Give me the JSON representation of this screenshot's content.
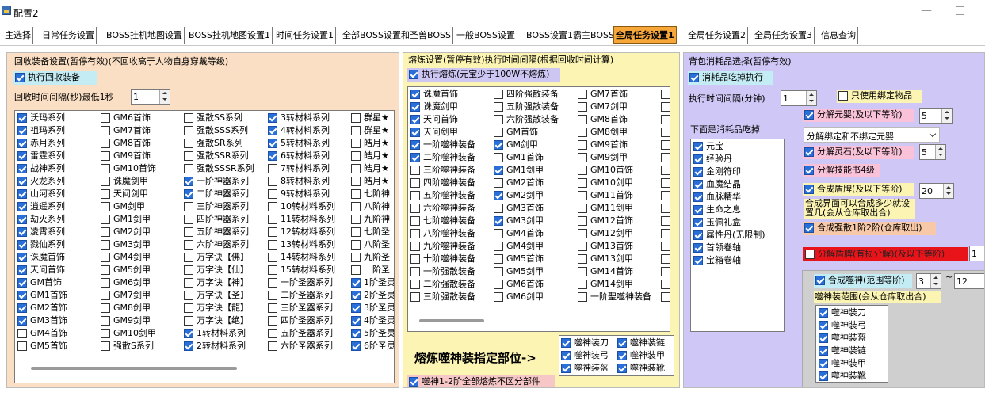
{
  "window": {
    "title": "配置2",
    "minimize": "—"
  },
  "tabs": [
    "主选择",
    "日常任务设置",
    "BOSS挂机地图设置",
    "BOSS挂机地图设置1",
    "时间任务设置1",
    "全部BOSS设置和圣兽BOSS",
    "一般BOSS设置",
    "BOSS设置1霸主BOSS",
    "全局任务设置1",
    "全局任务设置2",
    "全局任务设置3",
    "信息查询"
  ],
  "active_tab": "全局任务设置1",
  "colors": {
    "left_panel": "#fbdfc4",
    "mid_panel": "#fbf4b3",
    "right_panel": "#cfc8f6",
    "active_tab": "#f7a63a",
    "checkbox": "#2a6fd8"
  },
  "recycle": {
    "group_label": "回收装备设置(暂停有效)(不回收高于人物自身穿戴等级)",
    "exec_label": "执行回收装备",
    "interval_label": "回收时间间隔(秒)最低1秒",
    "interval_value": "1",
    "columns": [
      [
        {
          "t": "沃玛系列",
          "c": true
        },
        {
          "t": "祖玛系列",
          "c": true
        },
        {
          "t": "赤月系列",
          "c": true
        },
        {
          "t": "雷霆系列",
          "c": true
        },
        {
          "t": "战神系列",
          "c": true
        },
        {
          "t": "火龙系列",
          "c": true
        },
        {
          "t": "山河系列",
          "c": true
        },
        {
          "t": "逍遥系列",
          "c": true
        },
        {
          "t": "劫灭系列",
          "c": true
        },
        {
          "t": "凌霄系列",
          "c": true
        },
        {
          "t": "戮仙系列",
          "c": true
        },
        {
          "t": "诛魔首饰",
          "c": true
        },
        {
          "t": "天问首饰",
          "c": true
        },
        {
          "t": "GM首饰",
          "c": true
        },
        {
          "t": "GM1首饰",
          "c": true
        },
        {
          "t": "GM2首饰",
          "c": true
        },
        {
          "t": "GM3首饰",
          "c": true
        },
        {
          "t": "GM4首饰",
          "c": false
        },
        {
          "t": "GM5首饰",
          "c": false
        }
      ],
      [
        {
          "t": "GM6首饰",
          "c": false
        },
        {
          "t": "GM7首饰",
          "c": false
        },
        {
          "t": "GM8首饰",
          "c": false
        },
        {
          "t": "GM9首饰",
          "c": false
        },
        {
          "t": "GM10首饰",
          "c": false
        },
        {
          "t": "诛魔剑甲",
          "c": false
        },
        {
          "t": "天问剑甲",
          "c": false
        },
        {
          "t": "GM剑甲",
          "c": false
        },
        {
          "t": "GM1剑甲",
          "c": false
        },
        {
          "t": "GM2剑甲",
          "c": false
        },
        {
          "t": "GM3剑甲",
          "c": false
        },
        {
          "t": "GM4剑甲",
          "c": false
        },
        {
          "t": "GM5剑甲",
          "c": false
        },
        {
          "t": "GM6剑甲",
          "c": false
        },
        {
          "t": "GM7剑甲",
          "c": false
        },
        {
          "t": "GM8剑甲",
          "c": false
        },
        {
          "t": "GM9剑甲",
          "c": false
        },
        {
          "t": "GM10剑甲",
          "c": false
        },
        {
          "t": "强散S系列",
          "c": false
        }
      ],
      [
        {
          "t": "强散SS系列",
          "c": false
        },
        {
          "t": "强散SSS系列",
          "c": false
        },
        {
          "t": "强散SR系列",
          "c": false
        },
        {
          "t": "强散SSR系列",
          "c": false
        },
        {
          "t": "强散SSSR系列",
          "c": false
        },
        {
          "t": "一阶神器系列",
          "c": true
        },
        {
          "t": "二阶神器系列",
          "c": true
        },
        {
          "t": "三阶神器系列",
          "c": false
        },
        {
          "t": "四阶神器系列",
          "c": false
        },
        {
          "t": "五阶神器系列",
          "c": false
        },
        {
          "t": "六阶神器系列",
          "c": false
        },
        {
          "t": "万字诀【佛】",
          "c": false
        },
        {
          "t": "万字诀【仙】",
          "c": false
        },
        {
          "t": "万字诀【神】",
          "c": false
        },
        {
          "t": "万字诀【圣】",
          "c": false
        },
        {
          "t": "万字诀【龍】",
          "c": false
        },
        {
          "t": "万字诀【绝】",
          "c": false
        },
        {
          "t": "1转材料系列",
          "c": true
        },
        {
          "t": "2转材料系列",
          "c": true
        }
      ],
      [
        {
          "t": "3转材料系列",
          "c": true
        },
        {
          "t": "4转材料系列",
          "c": true
        },
        {
          "t": "5转材料系列",
          "c": true
        },
        {
          "t": "6转材料系列",
          "c": true
        },
        {
          "t": "7转材料系列",
          "c": false
        },
        {
          "t": "8转材料系列",
          "c": false
        },
        {
          "t": "9转材料系列",
          "c": false
        },
        {
          "t": "10转材料系列",
          "c": false
        },
        {
          "t": "11转材料系列",
          "c": false
        },
        {
          "t": "12转材料系列",
          "c": false
        },
        {
          "t": "13转材料系列",
          "c": false
        },
        {
          "t": "14转材料系列",
          "c": false
        },
        {
          "t": "15转材料系列",
          "c": false
        },
        {
          "t": "一阶圣器系列",
          "c": false
        },
        {
          "t": "二阶圣器系列",
          "c": false
        },
        {
          "t": "三阶圣器系列",
          "c": false
        },
        {
          "t": "四阶圣器系列",
          "c": false
        },
        {
          "t": "五阶圣器系列",
          "c": false
        },
        {
          "t": "六阶圣器系列",
          "c": false
        }
      ],
      [
        {
          "t": "群星★",
          "c": false
        },
        {
          "t": "群星★",
          "c": false
        },
        {
          "t": "皓月★",
          "c": false
        },
        {
          "t": "皓月★",
          "c": false
        },
        {
          "t": "皓月★",
          "c": false
        },
        {
          "t": "皓月★",
          "c": false
        },
        {
          "t": "七阶神",
          "c": false
        },
        {
          "t": "八阶神",
          "c": false
        },
        {
          "t": "九阶神",
          "c": false
        },
        {
          "t": "七阶圣",
          "c": false
        },
        {
          "t": "八阶圣",
          "c": false
        },
        {
          "t": "九阶圣",
          "c": false
        },
        {
          "t": "十阶圣",
          "c": false
        },
        {
          "t": "1阶圣灵",
          "c": true
        },
        {
          "t": "2阶圣灵",
          "c": true
        },
        {
          "t": "3阶圣灵",
          "c": true
        },
        {
          "t": "4阶圣灵",
          "c": true
        },
        {
          "t": "5阶圣灵",
          "c": true
        },
        {
          "t": "6阶圣灵",
          "c": true
        }
      ]
    ]
  },
  "smelt": {
    "group_label": "熔炼设置(暂停有效)执行时间间隔(根据回收时间计算)",
    "exec_label": "执行熔炼(元宝少于100W不熔炼)",
    "columns": [
      [
        {
          "t": "诛魔首饰",
          "c": true
        },
        {
          "t": "诛魔剑甲",
          "c": true
        },
        {
          "t": "天问首饰",
          "c": true
        },
        {
          "t": "天问剑甲",
          "c": true
        },
        {
          "t": "一阶噬神装备",
          "c": true
        },
        {
          "t": "二阶噬神装备",
          "c": true
        },
        {
          "t": "三阶噬神装备",
          "c": false
        },
        {
          "t": "四阶噬神装备",
          "c": false
        },
        {
          "t": "五阶噬神装备",
          "c": false
        },
        {
          "t": "六阶噬神装备",
          "c": false
        },
        {
          "t": "七阶噬神装备",
          "c": false
        },
        {
          "t": "八阶噬神装备",
          "c": false
        },
        {
          "t": "九阶噬神装备",
          "c": false
        },
        {
          "t": "十阶噬神装备",
          "c": false
        },
        {
          "t": "一阶强散装备",
          "c": false
        },
        {
          "t": "二阶强散装备",
          "c": false
        },
        {
          "t": "三阶强散装备",
          "c": false
        }
      ],
      [
        {
          "t": "四阶强散装备",
          "c": false
        },
        {
          "t": "五阶强散装备",
          "c": false
        },
        {
          "t": "六阶强散装备",
          "c": false
        },
        {
          "t": "GM首饰",
          "c": false
        },
        {
          "t": "GM剑甲",
          "c": true
        },
        {
          "t": "GM1首饰",
          "c": false
        },
        {
          "t": "GM1剑甲",
          "c": true
        },
        {
          "t": "GM2首饰",
          "c": false
        },
        {
          "t": "GM2剑甲",
          "c": true
        },
        {
          "t": "GM3首饰",
          "c": false
        },
        {
          "t": "GM3剑甲",
          "c": true
        },
        {
          "t": "GM4首饰",
          "c": false
        },
        {
          "t": "GM4剑甲",
          "c": false
        },
        {
          "t": "GM5首饰",
          "c": false
        },
        {
          "t": "GM5剑甲",
          "c": false
        },
        {
          "t": "GM6首饰",
          "c": false
        },
        {
          "t": "GM6剑甲",
          "c": false
        }
      ],
      [
        {
          "t": "GM7首饰",
          "c": false
        },
        {
          "t": "GM7剑甲",
          "c": false
        },
        {
          "t": "GM8首饰",
          "c": false
        },
        {
          "t": "GM8剑甲",
          "c": false
        },
        {
          "t": "GM9首饰",
          "c": false
        },
        {
          "t": "GM9剑甲",
          "c": false
        },
        {
          "t": "GM10首饰",
          "c": false
        },
        {
          "t": "GM10剑甲",
          "c": false
        },
        {
          "t": "GM11首饰",
          "c": false
        },
        {
          "t": "GM11剑甲",
          "c": false
        },
        {
          "t": "GM12首饰",
          "c": false
        },
        {
          "t": "GM12剑甲",
          "c": false
        },
        {
          "t": "GM13首饰",
          "c": false
        },
        {
          "t": "GM13剑甲",
          "c": false
        },
        {
          "t": "GM14首饰",
          "c": false
        },
        {
          "t": "GM14剑甲",
          "c": false
        },
        {
          "t": "一阶聖噬神装备",
          "c": false
        }
      ]
    ],
    "target_label": "熔炼噬神装指定部位->",
    "parts": [
      {
        "t": "噬神装刀",
        "c": true
      },
      {
        "t": "噬神装链",
        "c": true
      },
      {
        "t": "噬神装弓",
        "c": true
      },
      {
        "t": "噬神装甲",
        "c": true
      },
      {
        "t": "噬神装盔",
        "c": true
      },
      {
        "t": "噬神装靴",
        "c": true
      }
    ],
    "no_distinguish_label": "噬神1-2阶全部熔炼不区分部件"
  },
  "consume": {
    "group_label": "背包消耗品选择(暂停有效)",
    "exec_label": "消耗品吃掉执行",
    "interval_label": "执行时间间隔(分钟)",
    "interval_value": "1",
    "bind_label": "只使用绑定物品",
    "list_title": "下面是消耗品吃掉",
    "items": [
      {
        "t": "元宝",
        "c": true
      },
      {
        "t": "经验丹",
        "c": true
      },
      {
        "t": "金刚符印",
        "c": true
      },
      {
        "t": "血魔结晶",
        "c": true
      },
      {
        "t": "血脉精华",
        "c": true
      },
      {
        "t": "生命之息",
        "c": true
      },
      {
        "t": "玉佩礼盒",
        "c": true
      },
      {
        "t": "属性丹(无限制)",
        "c": true
      },
      {
        "t": "首领卷轴",
        "c": true
      },
      {
        "t": "宝箱卷轴",
        "c": true
      }
    ],
    "decompose_yuanying_label": "分解元婴(及以下等阶)",
    "decompose_yuanying_value": "5",
    "bind_dropdown_value": "分解绑定和不绑定元婴",
    "decompose_lingshi_label": "分解灵石(及以下等阶)",
    "decompose_lingshi_value": "5",
    "decompose_skillbook_label": "分解技能书4级",
    "merge_shield_label": "合成盾牌(及以下等阶)",
    "merge_shield_value": "20",
    "merge_note": "合成界面可以合成多少就设置几(会从仓库取出合)",
    "merge_qiangsan_label": "合成强散1阶2阶(仓库取出)",
    "decompose_shield_label": "分解盾牌(有损分解)(及以下等阶)",
    "decompose_shield_value": "1",
    "merge_shishen_label": "合成噬神(范围等阶)",
    "merge_shishen_from": "3",
    "merge_shishen_sep": "~",
    "merge_shishen_to": "12",
    "shishen_range_label": "噬神装范围(会从仓库取出合)",
    "shishen_parts": [
      {
        "t": "噬神装刀",
        "c": true
      },
      {
        "t": "噬神装弓",
        "c": true
      },
      {
        "t": "噬神装盔",
        "c": true
      },
      {
        "t": "噬神装链",
        "c": true
      },
      {
        "t": "噬神装甲",
        "c": true
      },
      {
        "t": "噬神装靴",
        "c": true
      }
    ]
  }
}
